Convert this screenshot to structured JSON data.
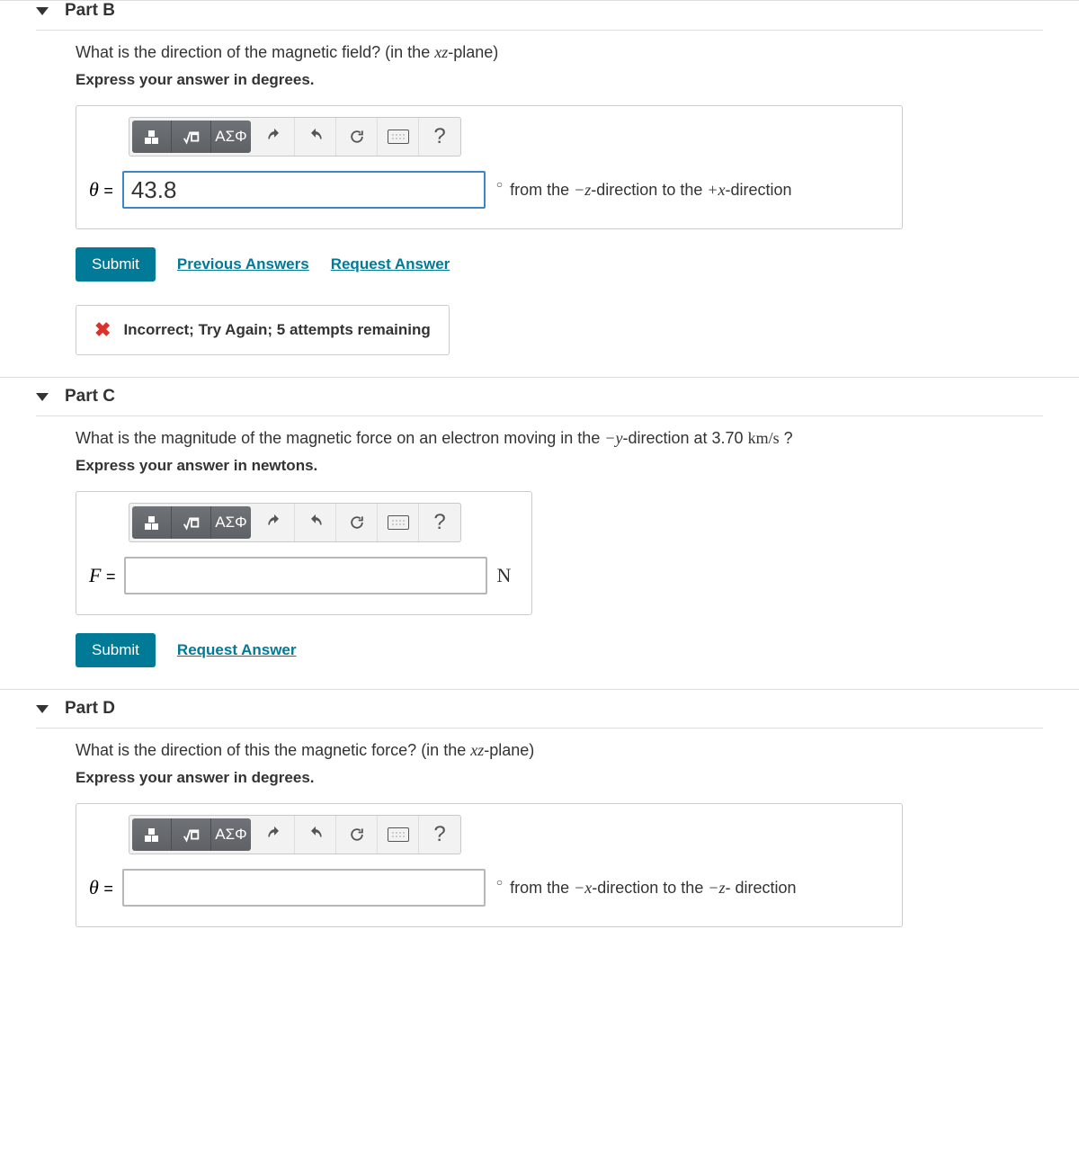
{
  "partB": {
    "title": "Part B",
    "question_pre": "What is the direction of the magnetic field? (in the ",
    "question_var": "xz",
    "question_post": "-plane)",
    "instruct": "Express your answer in degrees.",
    "var_label": "θ",
    "input_value": "43.8",
    "suffix_pre": "from the ",
    "suffix_v1": "−z",
    "suffix_mid": "-direction to the ",
    "suffix_v2": "+x",
    "suffix_post": "-direction",
    "submit_label": "Submit",
    "prev_label": "Previous Answers",
    "req_label": "Request Answer",
    "feedback": "Incorrect; Try Again; 5 attempts remaining"
  },
  "partC": {
    "title": "Part C",
    "question_pre": "What is the magnitude of the magnetic force on an electron moving in the ",
    "question_var": "−y",
    "question_mid": "-direction at 3.70 ",
    "question_unit": "km/s",
    "question_post": " ?",
    "instruct": "Express your answer in newtons.",
    "var_label": "F",
    "input_value": "",
    "suffix": "N",
    "submit_label": "Submit",
    "req_label": "Request Answer"
  },
  "partD": {
    "title": "Part D",
    "question_pre": "What is the direction of this the magnetic force? (in the ",
    "question_var": "xz",
    "question_post": "-plane)",
    "instruct": "Express your answer in degrees.",
    "var_label": "θ",
    "input_value": "",
    "suffix_pre": "from the ",
    "suffix_v1": "−x",
    "suffix_mid": "-direction to the ",
    "suffix_v2": "−z",
    "suffix_post": "- direction"
  },
  "toolbar": {
    "greek": "ΑΣΦ",
    "help": "?"
  }
}
